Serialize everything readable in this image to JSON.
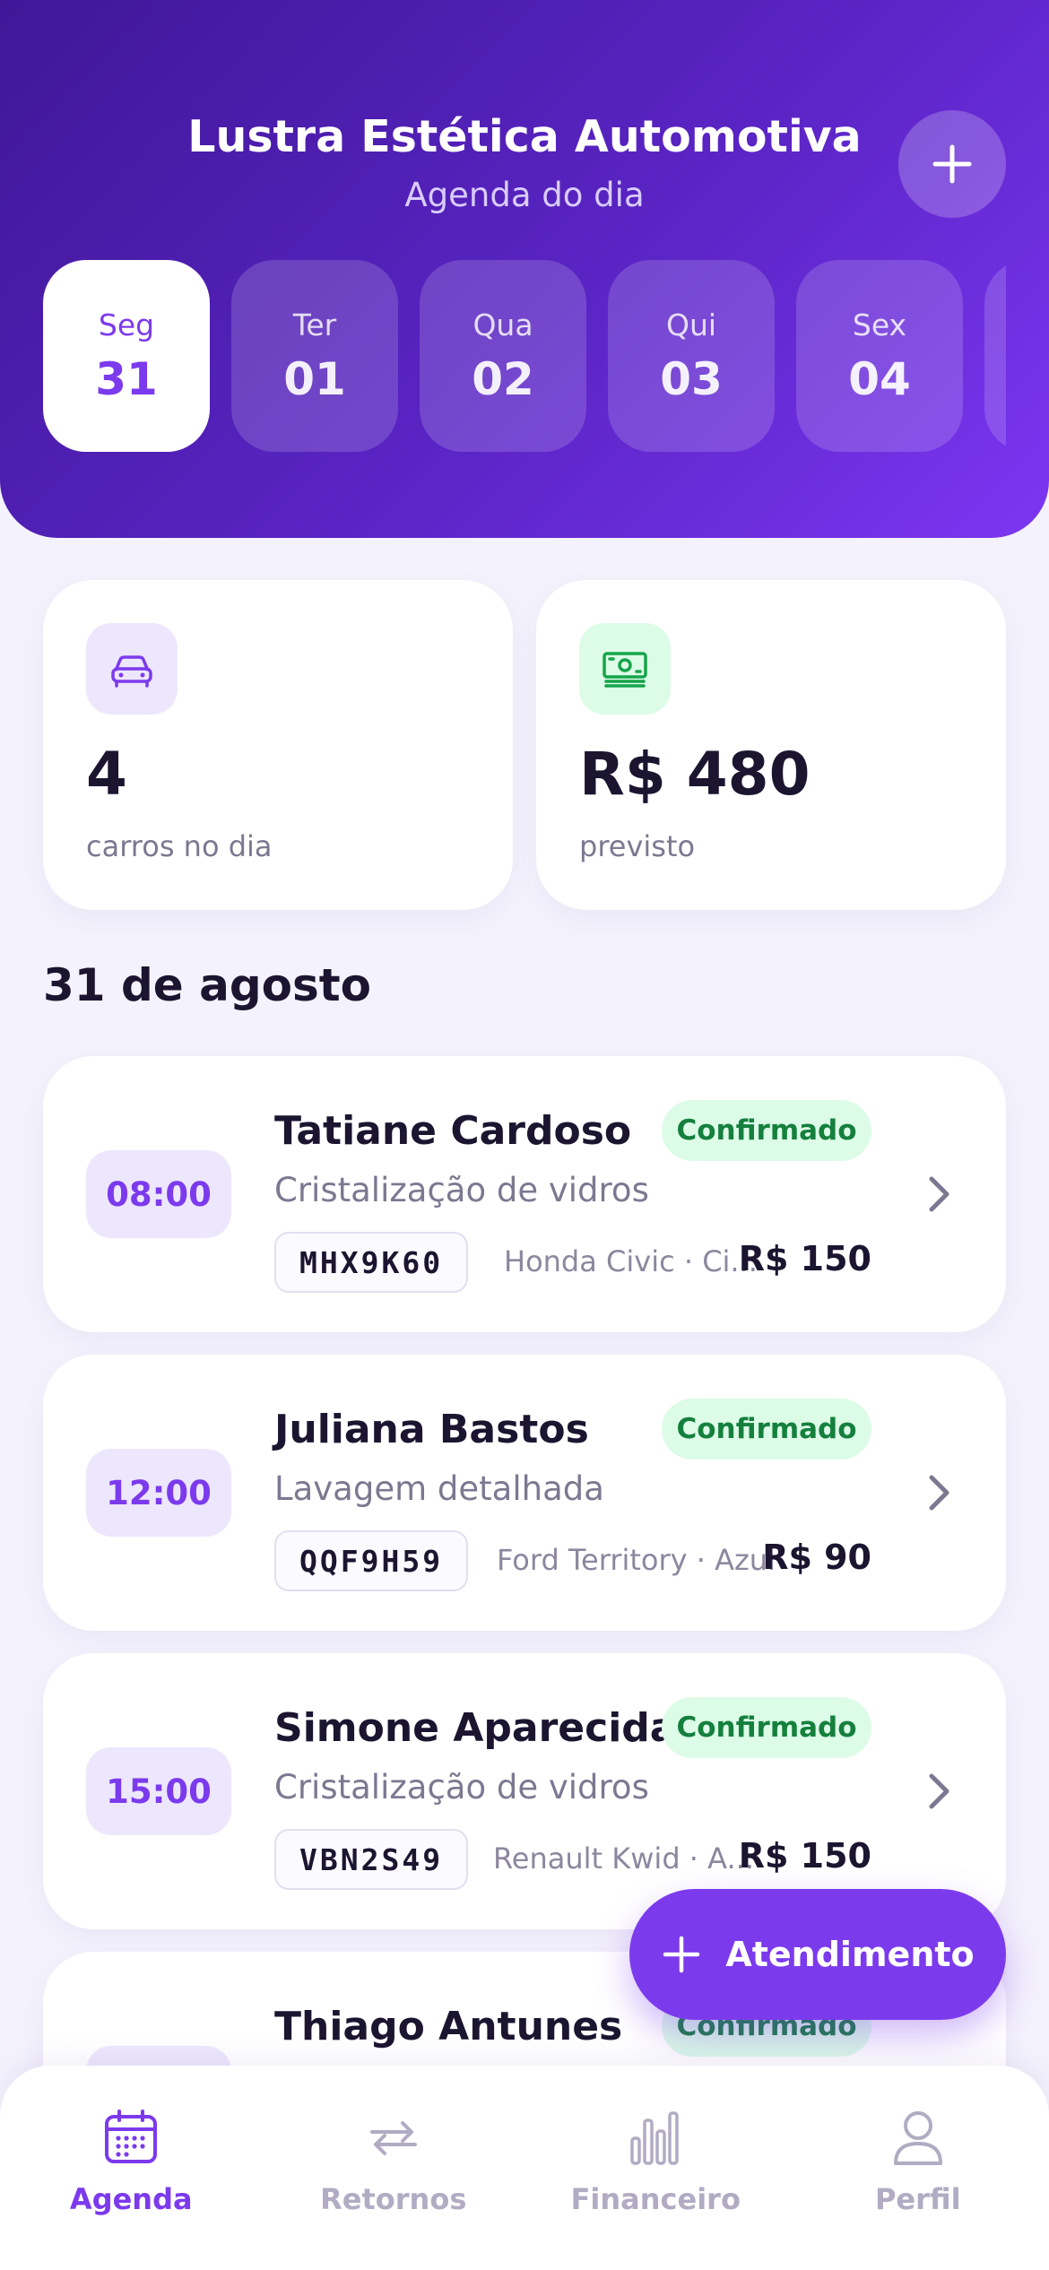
{
  "header": {
    "title": "Lustra Estética Automotiva",
    "subtitle": "Agenda do dia",
    "add_icon": "plus-icon"
  },
  "days": [
    {
      "dow": "Seg",
      "dom": "31",
      "active": true
    },
    {
      "dow": "Ter",
      "dom": "01",
      "active": false
    },
    {
      "dow": "Qua",
      "dom": "02",
      "active": false
    },
    {
      "dow": "Qui",
      "dom": "03",
      "active": false
    },
    {
      "dow": "Sex",
      "dom": "04",
      "active": false
    }
  ],
  "stats": {
    "cars": {
      "icon": "car-icon",
      "value": "4",
      "label": "carros no dia"
    },
    "money": {
      "icon": "cash-icon",
      "value": "R$ 480",
      "label": "previsto"
    }
  },
  "section_title": "31 de agosto",
  "appointments": [
    {
      "time": "08:00",
      "client": "Tatiane Cardoso",
      "status": "Confirmado",
      "service": "Cristalização de vidros",
      "plate": "MHX9K60",
      "vehicle": "Honda Civic · Ci...",
      "price": "R$ 150"
    },
    {
      "time": "12:00",
      "client": "Juliana Bastos",
      "status": "Confirmado",
      "service": "Lavagem detalhada",
      "plate": "QQF9H59",
      "vehicle": "Ford Territory · Azul",
      "price": "R$ 90"
    },
    {
      "time": "15:00",
      "client": "Simone Aparecida",
      "status": "Confirmado",
      "service": "Cristalização de vidros",
      "plate": "VBN2S49",
      "vehicle": "Renault Kwid · A...",
      "price": "R$ 150"
    },
    {
      "time": "",
      "client": "Thiago Antunes",
      "status": "Confirmado",
      "service": "",
      "plate": "",
      "vehicle": "",
      "price": ""
    }
  ],
  "fab": {
    "label": "Atendimento",
    "icon": "plus-icon"
  },
  "nav": [
    {
      "label": "Agenda",
      "icon": "calendar-icon",
      "active": true
    },
    {
      "label": "Retornos",
      "icon": "repeat-icon",
      "active": false
    },
    {
      "label": "Financeiro",
      "icon": "bar-chart-icon",
      "active": false
    },
    {
      "label": "Perfil",
      "icon": "user-icon",
      "active": false
    }
  ],
  "colors": {
    "primary": "#7c3aed",
    "header_start": "#3f1797",
    "header_end": "#7c36f2",
    "success_bg": "#dcfce7",
    "success_text": "#15803d"
  }
}
